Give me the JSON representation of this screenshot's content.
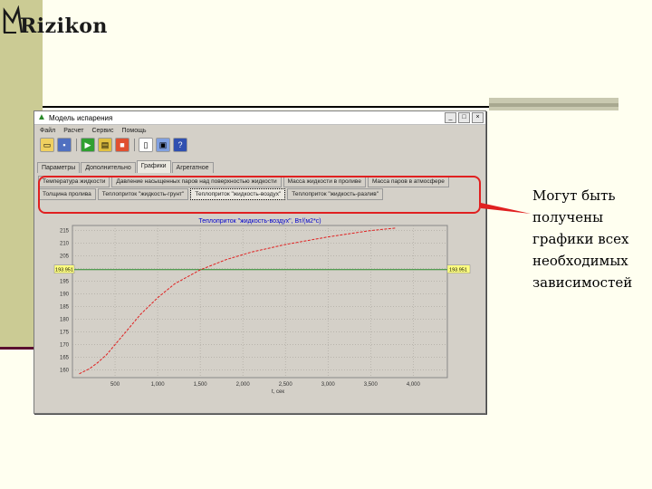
{
  "logo": {
    "text": "Rizikon"
  },
  "window": {
    "title": "Модель испарения",
    "controls": [
      "_",
      "□",
      "×"
    ],
    "menu": [
      "Файл",
      "Расчет",
      "Сервис",
      "Помощь"
    ],
    "toolbar_icons": [
      "open-folder-icon",
      "save-icon",
      "run-icon",
      "table-icon",
      "report-icon",
      "copy-icon",
      "print-icon",
      "help-icon"
    ],
    "tabs": [
      "Параметры",
      "Дополнительно",
      "Графики",
      "Агрегатное"
    ],
    "active_tab": 2,
    "subtabs_row1": [
      "Температура жидкости",
      "Давление насыщенных паров над поверхностью жидкости",
      "Масса жидкости в проливе",
      "Масса паров в атмосфере"
    ],
    "subtabs_row2": [
      "Толщина пролива",
      "Теплоприток \"жидкость-грунт\"",
      "Теплоприток \"жидкость-воздух\"",
      "Теплоприток \"жидкость-разлив\""
    ],
    "active_subtab": "Теплоприток \"жидкость-воздух\""
  },
  "chart_data": {
    "type": "line",
    "title": "Теплоприток \"жидкость-воздух\", Вт/(м2*с)",
    "xlabel": "t, сек",
    "ylabel": "",
    "x_ticks": [
      "500",
      "1,000",
      "1,500",
      "2,000",
      "2,500",
      "3,000",
      "3,500",
      "4,000"
    ],
    "y_ticks": [
      "160",
      "165",
      "170",
      "175",
      "180",
      "185",
      "190",
      "195",
      "200",
      "205",
      "210",
      "215"
    ],
    "xlim": [
      0,
      4400
    ],
    "ylim": [
      157,
      217
    ],
    "reference_line": {
      "value": 199.6,
      "label_left": "193.951",
      "label_right": "193.951"
    },
    "series": [
      {
        "color": "#e02020",
        "x": [
          80,
          200,
          300,
          400,
          500,
          600,
          800,
          1000,
          1200,
          1500,
          1800,
          2100,
          2500,
          3000,
          3500,
          3800
        ],
        "y": [
          158.5,
          160.5,
          163,
          166,
          170,
          174,
          182,
          188.5,
          194,
          199.5,
          203.5,
          206.5,
          209.5,
          212.5,
          215,
          216
        ]
      }
    ],
    "colors": {
      "reference": "#2a8a2a",
      "title": "#0000cc",
      "series": "#e02020"
    }
  },
  "caption": {
    "lines": [
      "Могут быть",
      "получены",
      "графики всех",
      "необходимых",
      "зависимостей"
    ]
  }
}
